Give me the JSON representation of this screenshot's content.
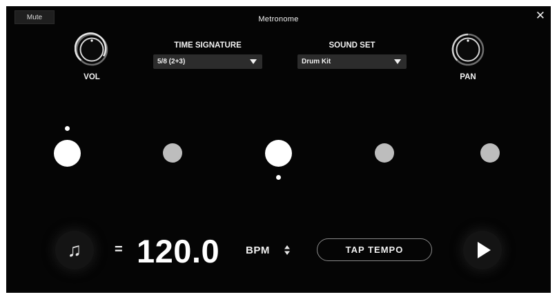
{
  "window": {
    "title": "Metronome",
    "mute_label": "Mute",
    "close_glyph": "✕"
  },
  "volume": {
    "label": "VOL"
  },
  "pan": {
    "label": "PAN"
  },
  "time_signature": {
    "label": "TIME SIGNATURE",
    "value": "5/8 (2+3)"
  },
  "sound_set": {
    "label": "SOUND SET",
    "value": "Drum Kit"
  },
  "beats": [
    {
      "accent": true,
      "playhead": "above"
    },
    {
      "accent": false,
      "playhead": "none"
    },
    {
      "accent": true,
      "playhead": "below"
    },
    {
      "accent": false,
      "playhead": "none"
    },
    {
      "accent": false,
      "playhead": "none"
    }
  ],
  "tempo": {
    "note_icon": "music-note-icon",
    "equals": "=",
    "value": "120.0",
    "unit": "BPM"
  },
  "tap_tempo": {
    "label": "TAP TEMPO"
  },
  "play": {
    "icon": "play-icon"
  },
  "colors": {
    "background": "#050505",
    "accent_beat": "#ffffff",
    "normal_beat": "#bdbdbd",
    "control": "#2c2c2c"
  }
}
